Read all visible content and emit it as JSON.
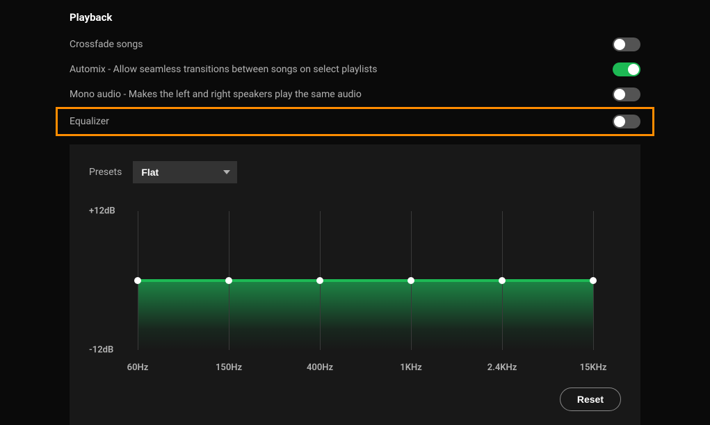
{
  "section_title": "Playback",
  "settings": {
    "crossfade": {
      "label": "Crossfade songs",
      "on": false
    },
    "automix": {
      "label": "Automix - Allow seamless transitions between songs on select playlists",
      "on": true
    },
    "mono": {
      "label": "Mono audio - Makes the left and right speakers play the same audio",
      "on": false
    },
    "equalizer": {
      "label": "Equalizer",
      "on": false
    }
  },
  "equalizer_panel": {
    "presets_label": "Presets",
    "preset_selected": "Flat",
    "y_top": "+12dB",
    "y_bottom": "-12dB",
    "reset_label": "Reset"
  },
  "chart_data": {
    "type": "line",
    "title": "Equalizer",
    "xlabel": "",
    "ylabel": "",
    "ylim": [
      -12,
      12
    ],
    "categories": [
      "60Hz",
      "150Hz",
      "400Hz",
      "1KHz",
      "2.4KHz",
      "15KHz"
    ],
    "values": [
      0,
      0,
      0,
      0,
      0,
      0
    ]
  }
}
